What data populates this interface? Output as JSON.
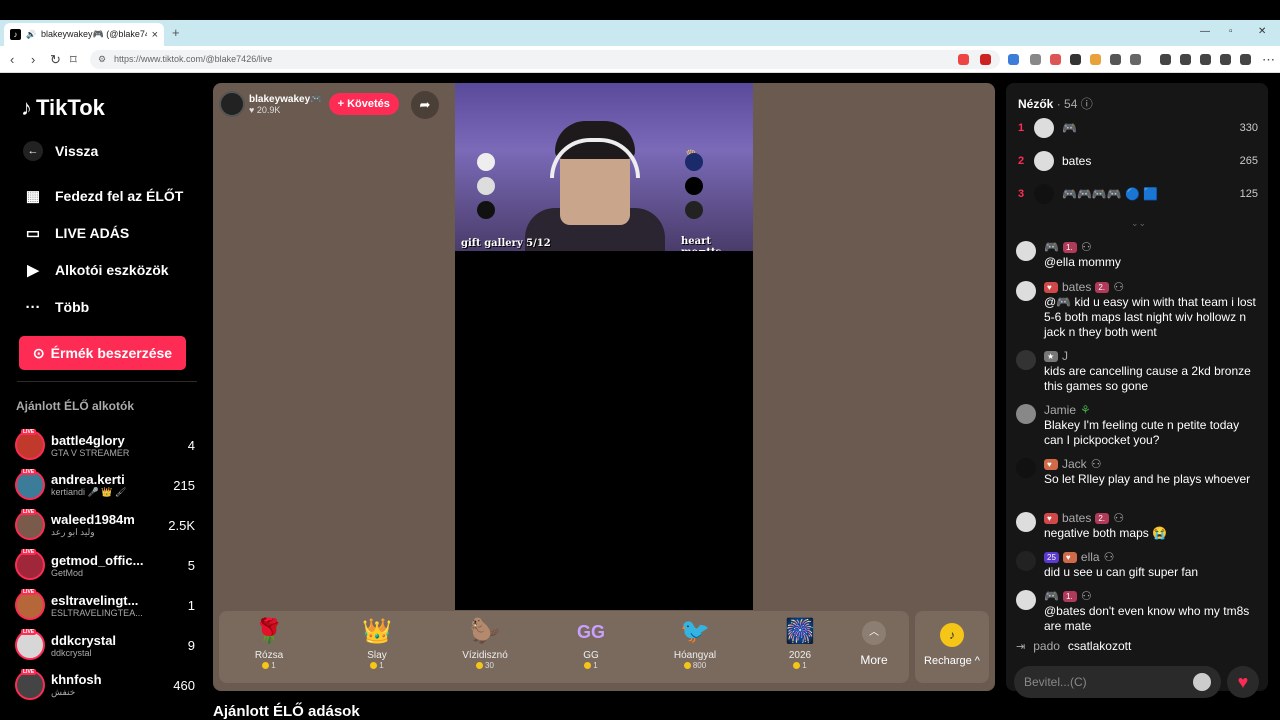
{
  "browser": {
    "tab_title": "blakeywakey🎮 (@blake7426)",
    "tab_close": "×",
    "new_tab": "+",
    "url": "https://www.tiktok.com/@blake7426/live"
  },
  "sidebar": {
    "logo": "TikTok",
    "nav": {
      "back": "Vissza",
      "explore": "Fedezd fel az ÉLŐT",
      "live": "LIVE ADÁS",
      "creator_tools": "Alkotói eszközök",
      "more": "Több"
    },
    "coins_button": "Érmék beszerzése",
    "recommended_title": "Ajánlott ÉLŐ alkotók",
    "live_badge": "LIVE",
    "creators": [
      {
        "name": "battle4glory",
        "sub": "GTA V STREAMER",
        "count": "4",
        "color": "#c0392b"
      },
      {
        "name": "andrea.kerti",
        "sub": "kertiandi 🎤 👑 🖌",
        "count": "215",
        "color": "#3b7d99"
      },
      {
        "name": "waleed1984m",
        "sub": "وليد ابو رعد",
        "count": "2.5K",
        "color": "#7a5a4a"
      },
      {
        "name": "getmod_offic...",
        "sub": "GetMod",
        "count": "5",
        "color": "#a0263a"
      },
      {
        "name": "esltravelingt...",
        "sub": "ESLTRAVELINGTEA...",
        "count": "1",
        "color": "#b5673a"
      },
      {
        "name": "ddkcrystal",
        "sub": "ddkcrystal",
        "count": "9",
        "color": "#d7d7d7"
      },
      {
        "name": "khnfosh",
        "sub": "خنفش",
        "count": "460",
        "color": "#444"
      }
    ]
  },
  "stream": {
    "host_name": "blakeywakey🎮",
    "host_likes": "20.9K",
    "follow_label": "+ Követés",
    "overlay_left": "gift gallery 5/12",
    "overlay_right": "heart me=tts",
    "gifts": [
      {
        "icon": "🌹",
        "name": "Rózsa",
        "price": "1"
      },
      {
        "icon": "👑",
        "name": "Slay",
        "price": "1"
      },
      {
        "icon": "🦫",
        "name": "Vízidisznó",
        "price": "30"
      },
      {
        "icon": "GG",
        "name": "GG",
        "price": "1"
      },
      {
        "icon": "🐦",
        "name": "Hóangyal",
        "price": "800"
      },
      {
        "icon": "🎆",
        "name": "2026",
        "price": "1"
      }
    ],
    "more_label": "More",
    "recharge_label": "Recharge ^",
    "recommended_lives": "Ajánlott ÉLŐ adások"
  },
  "viewers": {
    "title": "Nézők",
    "count": "· 54",
    "top": [
      {
        "rank": "1",
        "name": "🎮",
        "score": "330"
      },
      {
        "rank": "2",
        "name": "bates",
        "score": "265"
      },
      {
        "rank": "3",
        "name": "🎮🎮🎮🎮 🔵 🟦",
        "score": "125"
      }
    ]
  },
  "chat": [
    {
      "user": "🎮",
      "badges": [
        "1."
      ],
      "text": "@ella mommy"
    },
    {
      "user": "bates",
      "badges": [
        "2."
      ],
      "text": "@🎮 kid u easy win with that team i lost 5-6 both maps last night wiv hollowz n jack n they both went"
    },
    {
      "user": "J",
      "badges": [],
      "text": "kids are cancelling cause a 2kd bronze this games so gone"
    },
    {
      "user": "Jamie",
      "badges": [],
      "text": "Blakey I'm feeling cute n petite today can I pickpocket you?"
    },
    {
      "user": "Jack",
      "badges": [],
      "text": "So let Rlley play and he plays whoever"
    },
    {
      "user": "bates",
      "badges": [
        "2."
      ],
      "text": "negative both maps 😭"
    },
    {
      "user": "ella",
      "badges": [
        "25"
      ],
      "text": "did u see u can gift super fan"
    },
    {
      "user": "🎮",
      "badges": [
        "1."
      ],
      "text": "@bates don't even know who my tm8s are mate"
    }
  ],
  "joined": {
    "user": "pado",
    "text": "csatlakozott"
  },
  "input_placeholder": "Bevitel...(C)"
}
